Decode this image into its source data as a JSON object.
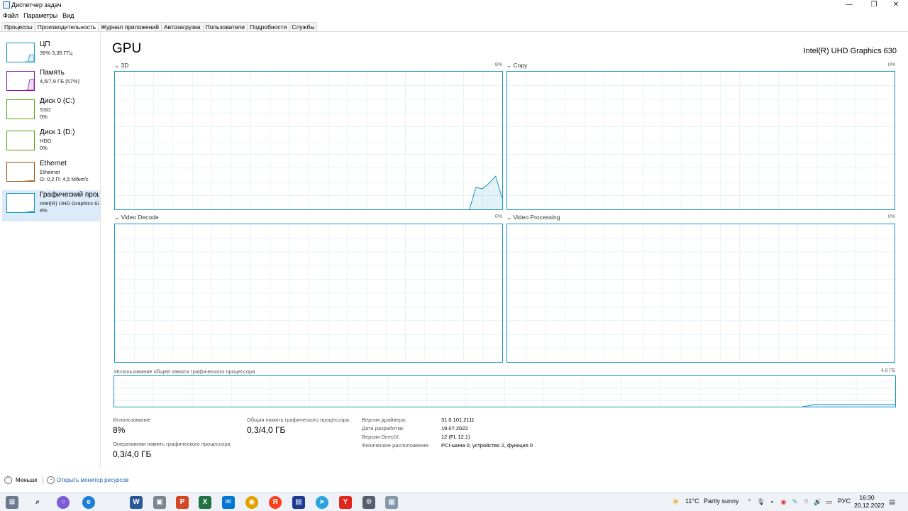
{
  "window": {
    "title": "Диспетчер задач",
    "controls": {
      "minimize": "—",
      "maximize": "❐",
      "close": "✕"
    }
  },
  "menu": [
    "Файл",
    "Параметры",
    "Вид"
  ],
  "tabs": [
    "Процессы",
    "Производительность",
    "Журнал приложений",
    "Автозагрузка",
    "Пользователи",
    "Подробности",
    "Службы"
  ],
  "active_tab": "Производительность",
  "sidebar": [
    {
      "name": "ЦП",
      "line1": "39% 3,35 ГГц",
      "line2": "",
      "color": "#1795c0",
      "level": 0.39
    },
    {
      "name": "Память",
      "line1": "4,5/7,9 ГБ (57%)",
      "line2": "",
      "color": "#8b12ae",
      "level": 0.57
    },
    {
      "name": "Диск 0 (C:)",
      "line1": "SSD",
      "line2": "0%",
      "color": "#4da60c",
      "level": 0.0
    },
    {
      "name": "Диск 1 (D:)",
      "line1": "HDD",
      "line2": "0%",
      "color": "#4da60c",
      "level": 0.0
    },
    {
      "name": "Ethernet",
      "line1": "Ethernet",
      "line2": "О: 0,2 П: 4,5 Мбит/с",
      "color": "#a74f01",
      "level": 0.05
    },
    {
      "name": "Графический процессор",
      "line1": "Intel(R) UHD Graphics 630",
      "line2": "8%",
      "color": "#1795c0",
      "level": 0.08
    }
  ],
  "main": {
    "title": "GPU",
    "gpu_name": "Intel(R) UHD Graphics 630",
    "engines": [
      {
        "label": "3D",
        "percent": "8%"
      },
      {
        "label": "Copy",
        "percent": "0%"
      },
      {
        "label": "Video Decode",
        "percent": "0%"
      },
      {
        "label": "Video Processing",
        "percent": "0%"
      }
    ],
    "shared_memory_label": "Использование общей памяти графического процессора",
    "shared_memory_max": "4,0 ГБ"
  },
  "chart_data": [
    {
      "type": "area",
      "title": "3D",
      "x": [
        0,
        1,
        2,
        3,
        4,
        5,
        6,
        7,
        8,
        9,
        10,
        11,
        12,
        13,
        14,
        15,
        16,
        17,
        18,
        19,
        20,
        21,
        22,
        23,
        24,
        25,
        26,
        27,
        28,
        29,
        30,
        31,
        32,
        33,
        34,
        35,
        36,
        37,
        38,
        39,
        40,
        41,
        42,
        43,
        44,
        45,
        46,
        47,
        48,
        49,
        50,
        51,
        52,
        53,
        54,
        55,
        56,
        57,
        58,
        59
      ],
      "values": [
        0,
        0,
        0,
        0,
        0,
        0,
        0,
        0,
        0,
        0,
        0,
        0,
        0,
        0,
        0,
        0,
        0,
        0,
        0,
        0,
        0,
        0,
        0,
        0,
        0,
        0,
        0,
        0,
        0,
        0,
        0,
        0,
        0,
        0,
        0,
        0,
        0,
        0,
        0,
        0,
        0,
        0,
        0,
        0,
        0,
        0,
        0,
        0,
        0,
        0,
        0,
        0,
        0,
        0,
        0,
        16,
        15,
        19,
        24,
        8
      ],
      "ylim": [
        0,
        100
      ]
    },
    {
      "type": "area",
      "title": "Использование общей памяти графического процессора",
      "values": [
        0,
        0,
        0,
        0,
        0,
        0,
        0,
        0,
        0,
        0,
        0,
        0,
        0,
        0,
        0,
        0,
        0,
        0,
        0,
        0,
        0,
        0,
        0,
        0,
        0,
        0,
        0,
        0,
        0,
        0,
        0,
        0,
        0,
        0,
        0,
        0,
        0,
        0,
        0,
        0,
        0,
        0,
        0,
        0,
        0,
        0,
        0,
        0,
        0,
        0,
        0,
        0,
        0,
        7.5,
        7.5,
        7.5,
        7.5,
        7.5,
        7.5,
        7.5
      ],
      "ylim": [
        0,
        100
      ]
    }
  ],
  "stats": {
    "usage_label": "Использование",
    "usage_value": "8%",
    "shared_label": "Общая память графического процессора",
    "shared_value": "0,3/4,0 ГБ",
    "dedicated_label": "Оперативная память графического процессора",
    "dedicated_value": "0,3/4,0 ГБ"
  },
  "info": [
    {
      "label": "Версия драйвера:",
      "value": "31.0.101.2111"
    },
    {
      "label": "Дата разработки:",
      "value": "19.07.2022"
    },
    {
      "label": "Версия DirectX:",
      "value": "12 (FL 12.1)"
    },
    {
      "label": "Физическое расположение:",
      "value": "PCI-шина 0, устройство 2, функция 0"
    }
  ],
  "footer": {
    "less": "Меньше",
    "monitor": "Открыть монитор ресурсов"
  },
  "taskbar": {
    "weather_temp": "11°C",
    "weather_text": "Partly sunny",
    "lang": "РУС",
    "time": "16:30",
    "date": "20.12.2022"
  }
}
